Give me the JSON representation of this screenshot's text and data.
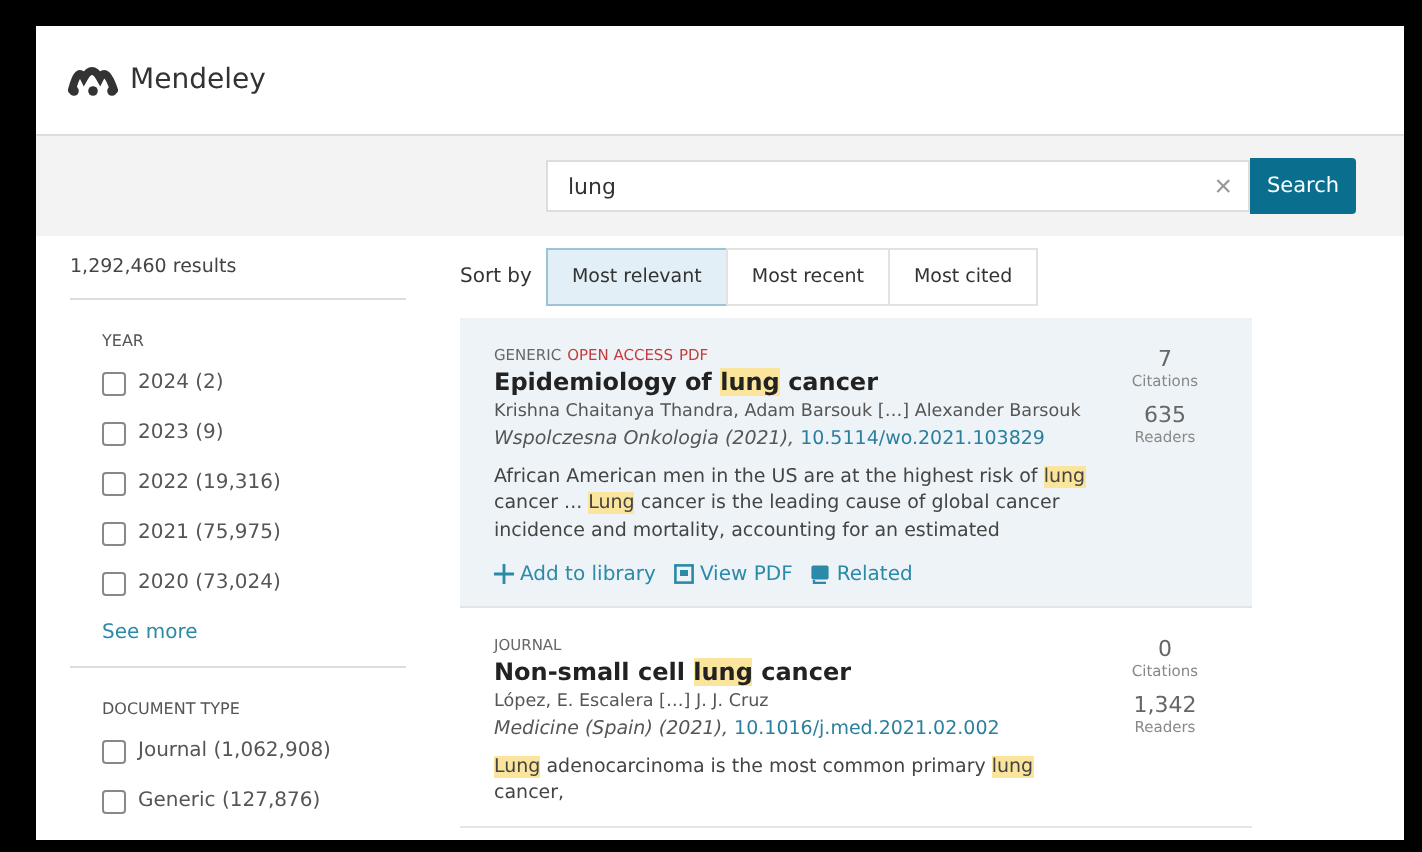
{
  "header": {
    "brand": "Mendeley"
  },
  "search": {
    "value": "lung",
    "clear": "×",
    "button": "Search"
  },
  "results_count": "1,292,460 results",
  "filters": [
    {
      "title": "YEAR",
      "options": [
        {
          "label": "2024 (2)",
          "checked": false
        },
        {
          "label": "2023 (9)",
          "checked": false
        },
        {
          "label": "2022 (19,316)",
          "checked": false
        },
        {
          "label": "2021 (75,975)",
          "checked": false
        },
        {
          "label": "2020 (73,024)",
          "checked": false
        }
      ],
      "more": "See more"
    },
    {
      "title": "DOCUMENT TYPE",
      "options": [
        {
          "label": "Journal (1,062,908)",
          "checked": false
        },
        {
          "label": "Generic (127,876)",
          "checked": false
        }
      ]
    }
  ],
  "sort": {
    "label": "Sort by",
    "options": [
      {
        "label": "Most relevant",
        "selected": true
      },
      {
        "label": "Most recent",
        "selected": false
      },
      {
        "label": "Most cited",
        "selected": false
      }
    ]
  },
  "results": [
    {
      "selected": true,
      "tags": [
        {
          "text": "GENERIC",
          "kind": "type"
        },
        {
          "text": "OPEN ACCESS",
          "kind": "access"
        },
        {
          "text": "PDF",
          "kind": "access"
        }
      ],
      "title": [
        {
          "text": "Epidemiology of ",
          "highlight": false
        },
        {
          "text": "lung",
          "highlight": true
        },
        {
          "text": " cancer",
          "highlight": false
        }
      ],
      "authors": "Krishna Chaitanya Thandra, Adam Barsouk […] Alexander Barsouk",
      "source": "Wspolczesna Onkologia (2021),",
      "doi": "10.5114/wo.2021.103829",
      "abstract": [
        {
          "text": "African American men in the US are at the highest risk of ",
          "highlight": false
        },
        {
          "text": "lung",
          "highlight": true
        },
        {
          "text": " cancer ... ",
          "highlight": false
        },
        {
          "text": "Lung",
          "highlight": true
        },
        {
          "text": " cancer is the leading cause of global cancer incidence and mortality, accounting for an estimated",
          "highlight": false
        }
      ],
      "citations": "7",
      "citations_label": "Citations",
      "readers": "635",
      "readers_label": "Readers",
      "actions": [
        {
          "kind": "add",
          "label": "Add to library"
        },
        {
          "kind": "pdf",
          "label": "View PDF"
        },
        {
          "kind": "related",
          "label": "Related"
        }
      ]
    },
    {
      "selected": false,
      "tags": [
        {
          "text": "JOURNAL",
          "kind": "type"
        }
      ],
      "title": [
        {
          "text": "Non-small cell ",
          "highlight": false
        },
        {
          "text": "lung",
          "highlight": true
        },
        {
          "text": " cancer",
          "highlight": false
        }
      ],
      "authors": "López, E. Escalera […] J. J. Cruz",
      "source": "Medicine (Spain) (2021),",
      "doi": "10.1016/j.med.2021.02.002",
      "abstract": [
        {
          "text": "Lung",
          "highlight": true
        },
        {
          "text": " adenocarcinoma is the most common primary ",
          "highlight": false
        },
        {
          "text": "lung",
          "highlight": true
        },
        {
          "text": " cancer,",
          "highlight": false
        }
      ],
      "citations": "0",
      "citations_label": "Citations",
      "readers": "1,342",
      "readers_label": "Readers"
    }
  ]
}
